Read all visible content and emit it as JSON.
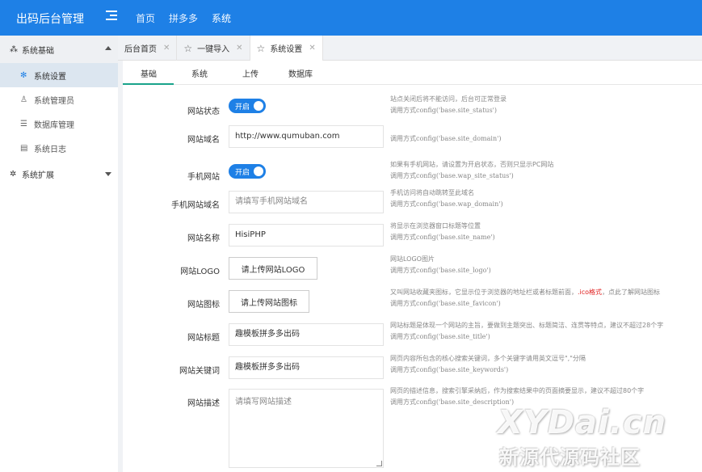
{
  "app": {
    "title": "出码后台管理"
  },
  "topnav": {
    "items": [
      "首页",
      "拼多多",
      "系统"
    ],
    "active": "系统"
  },
  "sidebar": {
    "group1": {
      "label": "系统基础",
      "icon": "modules-icon"
    },
    "items": [
      {
        "label": "系统设置",
        "icon": "gear-icon"
      },
      {
        "label": "系统管理员",
        "icon": "user-icon"
      },
      {
        "label": "数据库管理",
        "icon": "database-icon"
      },
      {
        "label": "系统日志",
        "icon": "log-icon"
      }
    ],
    "group2": {
      "label": "系统扩展",
      "icon": "gear-icon"
    }
  },
  "tabs": [
    {
      "label": "后台首页"
    },
    {
      "label": "一键导入"
    },
    {
      "label": "系统设置"
    }
  ],
  "subtabs": [
    "基础",
    "系统",
    "上传",
    "数据库"
  ],
  "form": {
    "site_status": {
      "label": "网站状态",
      "switch_text": "开启",
      "hint1": "站点关闭后将不能访问，后台可正常登录",
      "hint2_prefix": "调用方式",
      "hint2_code": "config('base.site_status')"
    },
    "site_domain": {
      "label": "网站域名",
      "value": "http://www.qumuban.com",
      "hint2_prefix": "调用方式",
      "hint2_code": "config('base.site_domain')"
    },
    "wap_status": {
      "label": "手机网站",
      "switch_text": "开启",
      "hint1": "如果有手机网站，请设置为开启状态，否则只显示PC网站",
      "hint2_prefix": "调用方式",
      "hint2_code": "config('base.wap_site_status')"
    },
    "wap_domain": {
      "label": "手机网站域名",
      "placeholder": "请填写手机网站域名",
      "hint1": "手机访问将自动跳转至此域名",
      "hint2_prefix": "调用方式",
      "hint2_code": "config('base.wap_domain')"
    },
    "site_name": {
      "label": "网站名称",
      "value": "HisiPHP",
      "hint1": "将显示在浏览器窗口标题等位置",
      "hint2_prefix": "调用方式",
      "hint2_code": "config('base.site_name')"
    },
    "site_logo": {
      "label": "网站LOGO",
      "button": "请上传网站LOGO",
      "hint1": "网站LOGO图片",
      "hint2_prefix": "调用方式",
      "hint2_code": "config('base.site_logo')"
    },
    "site_favicon": {
      "label": "网站图标",
      "button": "请上传网站图标",
      "hint1_a": "又叫网站收藏夹图标，它显示位于浏览器的地址栏或者标题前面，",
      "hint1_red": ".ico格式",
      "hint1_b": "，点此了解网站图标",
      "hint2_prefix": "调用方式",
      "hint2_code": "config('base.site_favicon')"
    },
    "site_title": {
      "label": "网站标题",
      "value": "趣模板拼多多出码",
      "hint1": "网站标题是体现一个网站的主旨，要做到主题突出、标题简洁、连贯等特点，建议不超过28个字",
      "hint2_prefix": "调用方式",
      "hint2_code": "config('base.site_title')"
    },
    "site_keywords": {
      "label": "网站关键词",
      "value": "趣模板拼多多出码",
      "hint1": "网页内容所包含的核心搜索关键词，多个关键字请用英文逗号\",\"分隔",
      "hint2_prefix": "调用方式",
      "hint2_code": "config('base.site_keywords')"
    },
    "site_description": {
      "label": "网站描述",
      "placeholder": "请填写网站描述",
      "hint1": "网页的描述信息，搜索引擎采纳后，作为搜索结果中的页面摘要显示，建议不超过80个字",
      "hint2_prefix": "调用方式",
      "hint2_code": "config('base.site_description')"
    }
  },
  "watermark": {
    "line1": "XYDai.cn",
    "line2": "新源代源码社区"
  },
  "colors": {
    "primary": "#1e80e6",
    "tab_accent": "#19a38b",
    "warning": "#e02020"
  }
}
